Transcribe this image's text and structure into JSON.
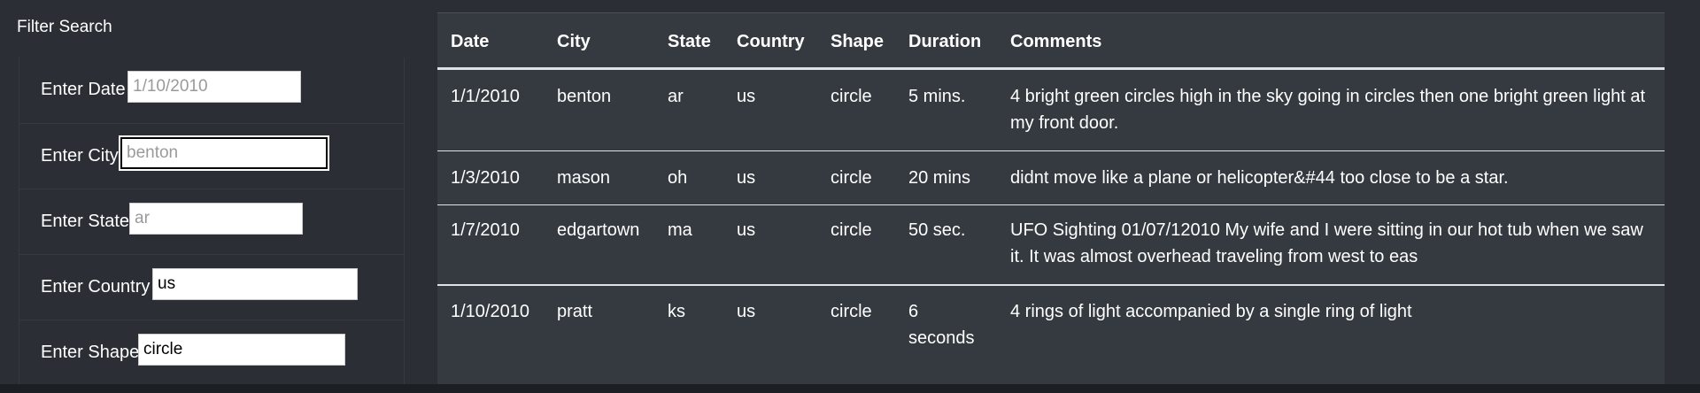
{
  "filter": {
    "title": "Filter Search",
    "fields": [
      {
        "label": "Enter Date",
        "value": "",
        "placeholder": "1/10/2010"
      },
      {
        "label": "Enter City",
        "value": "",
        "placeholder": "benton"
      },
      {
        "label": "Enter State",
        "value": "",
        "placeholder": "ar"
      },
      {
        "label": "Enter Country",
        "value": "us",
        "placeholder": ""
      },
      {
        "label": "Enter Shape",
        "value": "circle",
        "placeholder": ""
      }
    ]
  },
  "table": {
    "headers": [
      "Date",
      "City",
      "State",
      "Country",
      "Shape",
      "Duration",
      "Comments"
    ],
    "rows": [
      {
        "date": "1/1/2010",
        "city": "benton",
        "state": "ar",
        "country": "us",
        "shape": "circle",
        "duration": "5 mins.",
        "comments": "4 bright green circles high in the sky going in circles then one bright green light at my front door."
      },
      {
        "date": "1/3/2010",
        "city": "mason",
        "state": "oh",
        "country": "us",
        "shape": "circle",
        "duration": "20 mins",
        "comments": "didnt move like a plane or helicopter&#44 too close to be a star."
      },
      {
        "date": "1/7/2010",
        "city": "edgartown",
        "state": "ma",
        "country": "us",
        "shape": "circle",
        "duration": "50 sec.",
        "comments": "UFO Sighting 01/07/12010 My wife and I were sitting in our hot tub when we saw it. It was almost overhead traveling from west to eas"
      },
      {
        "date": "1/10/2010",
        "city": "pratt",
        "state": "ks",
        "country": "us",
        "shape": "circle",
        "duration": "6 seconds",
        "comments": "4 rings of light accompanied by a single ring of light"
      }
    ]
  }
}
